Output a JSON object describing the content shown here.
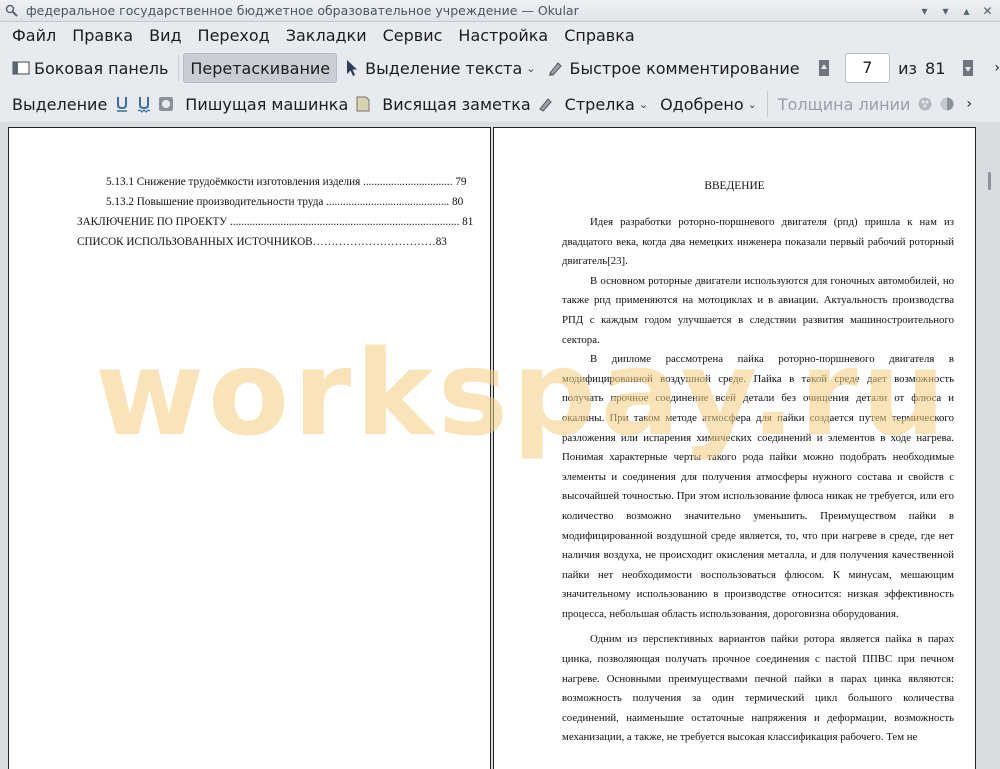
{
  "window": {
    "title": "федеральное государственное бюджетное образовательное учреждение — Okular"
  },
  "menu": [
    "Файл",
    "Правка",
    "Вид",
    "Переход",
    "Закладки",
    "Сервис",
    "Настройка",
    "Справка"
  ],
  "toolbar1": {
    "sidebar": "Боковая панель",
    "drag": "Перетаскивание",
    "text_select": "Выделение текста",
    "quick_comment": "Быстрое комментирование",
    "page_current": "7",
    "page_of": "из",
    "page_total": "81"
  },
  "toolbar2": {
    "selection": "Выделение",
    "typewriter": "Пишущая машинка",
    "note": "Висящая заметка",
    "arrow": "Стрелка",
    "approved": "Одобрено",
    "line_width": "Толщина линии"
  },
  "left_page": {
    "toc": [
      {
        "text": "5.13.1 Снижение трудоёмкости изготовления изделия ................................ 79"
      },
      {
        "text": "5.13.2 Повышение производительности труда ............................................ 80"
      },
      {
        "text": "ЗАКЛЮЧЕНИЕ ПО ПРОЕКТУ .................................................................................. 81"
      },
      {
        "text": "СПИСОК ИСПОЛЬЗОВАННЫХ ИСТОЧНИКОВ……………………………83"
      }
    ]
  },
  "right_page": {
    "heading": "ВВЕДЕНИЕ",
    "paragraphs": [
      "Идея разработки роторно-поршневого двигателя (рпд) пришла к нам из двадцатого века, когда два немецких инженера показали первый рабочий роторный двигатель[23].",
      "В основном роторные двигатели используются для гоночных автомобилей, но также рпд применяются на мотоциклах и в авиации. Актуальность производства РПД с каждым годом улучшается в следствии развития машиностроительного сектора.",
      "В дипломе рассмотрена пайка роторно-поршневого двигателя в модифицированной воздушной среде. Пайка в такой среде дает возможность получать прочное соединение всей детали без очищения детали от флюса и окалины. При таком методе атмосфера для пайки создается путем термического разложения или испарения химических соединений и элементов в ходе нагрева. Понимая характерные черты такого рода пайки можно подобрать необходимые элементы и соединения для получения атмосферы нужного состава и свойств с высочайшей точностью. При этом использование флюса никак не требуется, или его количество возможно значительно уменьшить. Преимуществом пайки в модифицированной воздушной среде является, то, что при нагреве в среде, где нет наличия воздуха, не происходит окисления металла, и для получения качественной пайки нет необходимости воспользоваться флюсом. К минусам, мешающим значительному использованию в производстве относится: низкая эффективность процесса, небольшая область использования, дороговизна оборудования.",
      "Одним из перспективных вариантов пайки ротора является пайка в парах цинка, позволяющая получать прочное соединения с пастой ППВС при печном нагреве. Основными преимуществами печной пайки в парах цинка являются: возможность получения за один термический цикл большого количества соединений, наименьшие остаточные напряжения и деформации, возможность механизации, а также, не требуется высокая классификация рабочего. Тем не"
    ]
  },
  "watermark": "workspay.ru"
}
